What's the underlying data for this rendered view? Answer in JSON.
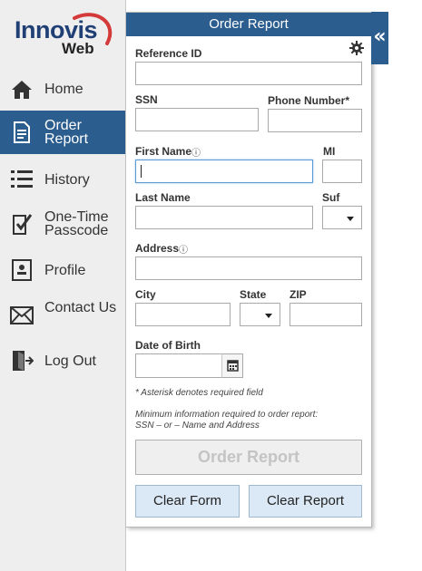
{
  "brand": {
    "name": "Innovis",
    "sub": "Web",
    "colors": {
      "primary": "#2b5d8f",
      "logo_swoosh": "#d43a3a"
    }
  },
  "sidebar": {
    "items": [
      {
        "icon": "home-icon",
        "label": "Home"
      },
      {
        "icon": "document-icon",
        "label": "Order Report",
        "active": true
      },
      {
        "icon": "list-icon",
        "label": "History"
      },
      {
        "icon": "checkmark-clipboard-icon",
        "label": "One-Time Passcode"
      },
      {
        "icon": "profile-card-icon",
        "label": "Profile"
      },
      {
        "icon": "envelope-icon",
        "label": "Contact Us"
      },
      {
        "icon": "logout-icon",
        "label": "Log Out"
      }
    ]
  },
  "panel": {
    "title": "Order Report",
    "collapse_glyph": "«",
    "fields": {
      "reference_id": {
        "label": "Reference ID",
        "value": ""
      },
      "ssn": {
        "label": "SSN",
        "value": ""
      },
      "phone": {
        "label": "Phone Number*",
        "value": ""
      },
      "first_name": {
        "label": "First Name",
        "help": "ⓘ",
        "value": ""
      },
      "mi": {
        "label": "MI",
        "value": ""
      },
      "last_name": {
        "label": "Last Name",
        "value": ""
      },
      "suffix": {
        "label": "Suf",
        "value": ""
      },
      "address": {
        "label": "Address",
        "help": "ⓘ",
        "value": ""
      },
      "city": {
        "label": "City",
        "value": ""
      },
      "state": {
        "label": "State",
        "value": ""
      },
      "zip": {
        "label": "ZIP",
        "value": ""
      },
      "dob": {
        "label": "Date of Birth",
        "value": ""
      }
    },
    "notes": {
      "asterisk": "* Asterisk denotes required field",
      "min_line1": "Minimum information required to order report:",
      "min_line2": "SSN – or – Name and Address"
    },
    "buttons": {
      "order": "Order Report",
      "clear_form": "Clear Form",
      "clear_report": "Clear Report"
    }
  }
}
